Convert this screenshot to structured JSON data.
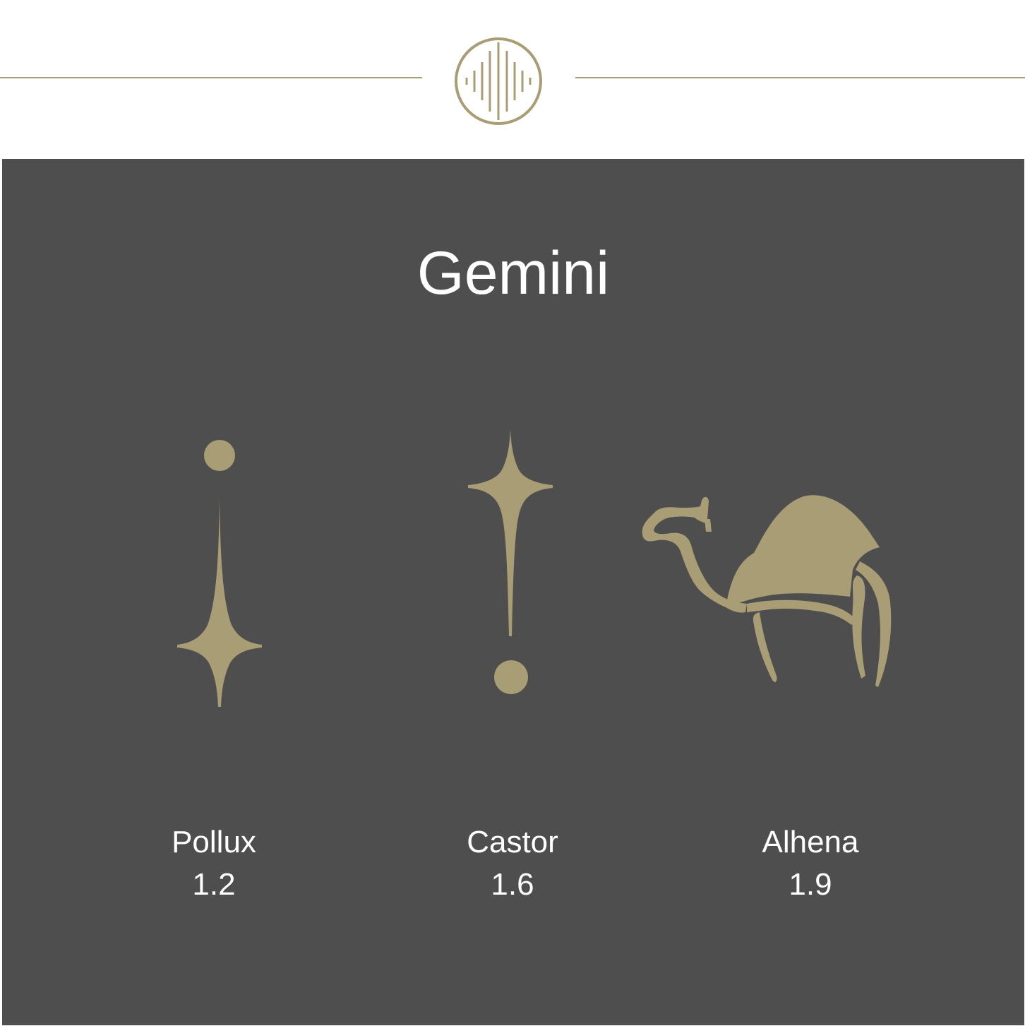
{
  "title": "Gemini",
  "accent_color": "#a89d74",
  "panel_color": "#4e4e4e",
  "header": {
    "emblem_icon": "sound-wave-circle-icon"
  },
  "stars": [
    {
      "name": "Pollux",
      "magnitude": "1.2",
      "icon": "inverted-star-with-dot-icon"
    },
    {
      "name": "Castor",
      "magnitude": "1.6",
      "icon": "star-exclamation-icon"
    },
    {
      "name": "Alhena",
      "magnitude": "1.9",
      "icon": "camel-icon"
    }
  ]
}
